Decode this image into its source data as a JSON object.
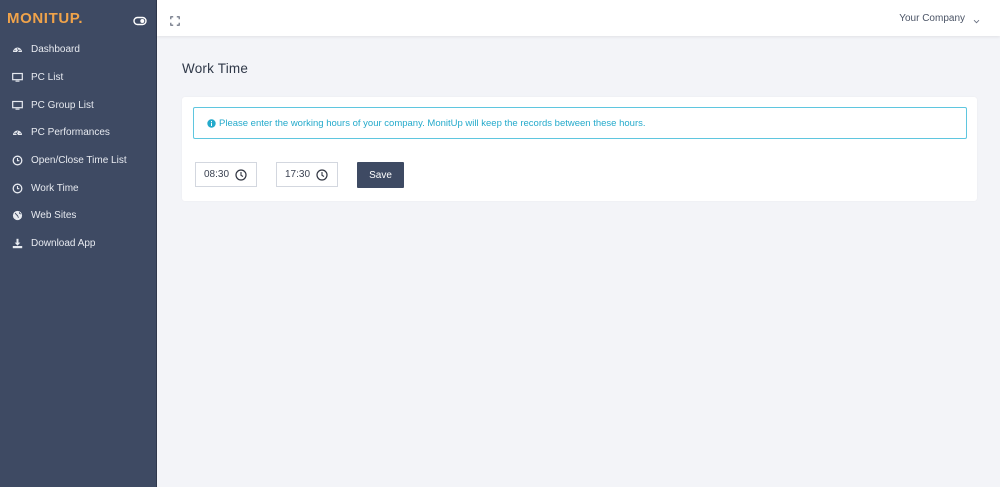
{
  "brand": {
    "logo": "MONITUP."
  },
  "sidebar": {
    "items": [
      {
        "label": "Dashboard",
        "icon": "dashboard-icon"
      },
      {
        "label": "PC List",
        "icon": "monitor-icon"
      },
      {
        "label": "PC Group List",
        "icon": "monitor-icon"
      },
      {
        "label": "PC Performances",
        "icon": "gauge-icon"
      },
      {
        "label": "Open/Close Time List",
        "icon": "clock-icon"
      },
      {
        "label": "Work Time",
        "icon": "clock-icon"
      },
      {
        "label": "Web Sites",
        "icon": "globe-icon"
      },
      {
        "label": "Download App",
        "icon": "download-icon"
      }
    ]
  },
  "topbar": {
    "company": "Your Company"
  },
  "main": {
    "title": "Work Time",
    "alert": "Please enter the working hours of your company. MonitUp will keep the records between these hours.",
    "start_time": "08:30",
    "end_time": "17:30",
    "save_label": "Save"
  },
  "colors": {
    "sidebar_bg": "#3e4a63",
    "logo": "#f0a34a",
    "alert": "#24aacb",
    "save_button": "#3e4a63"
  }
}
